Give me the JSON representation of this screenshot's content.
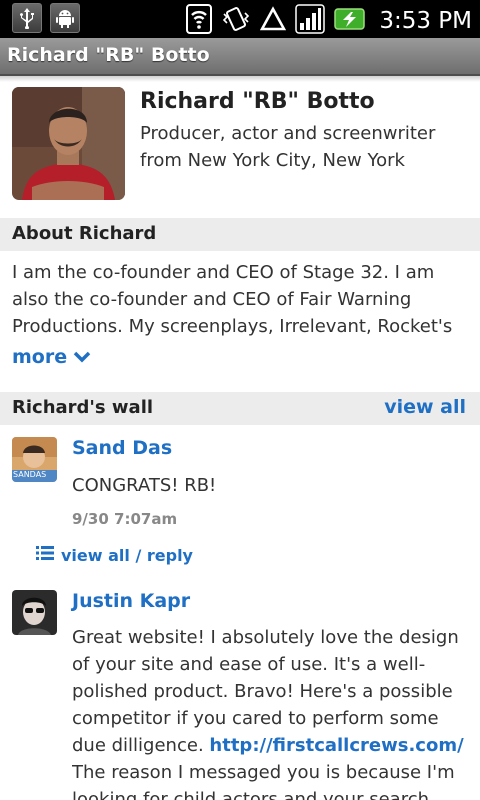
{
  "status_bar": {
    "time": "3:53 PM",
    "icons": [
      "usb-icon",
      "android-debug-icon",
      "wifi-icon",
      "vibrate-icon",
      "warning-icon",
      "signal-icon",
      "battery-charging-icon"
    ]
  },
  "title_bar": {
    "title": "Richard \"RB\" Botto"
  },
  "profile": {
    "name": "Richard \"RB\" Botto",
    "description": "Producer, actor and screenwriter from New York City, New York"
  },
  "about": {
    "header": "About Richard",
    "text": "I am the co-founder and CEO of Stage 32. I am also the co-founder and CEO of Fair Warning Productions. My screenplays, Irrelevant, Rocket's",
    "more_label": "more"
  },
  "wall": {
    "header": "Richard's wall",
    "view_all_label": "view all",
    "posts": [
      {
        "author": "Sand Das",
        "avatar_caption": "SANDAS",
        "text": "CONGRATS! RB!",
        "time": "9/30 7:07am",
        "reply_label": "view all / reply"
      },
      {
        "author": "Justin Kapr",
        "text_before_link": "Great website! I absolutely love the design of your site and ease of use. It's a well-polished product. Bravo! Here's a possible competitor if you cared to perform some due dilligence.",
        "link": "http://firstcallcrews.com/",
        "text_after_link": " The reason I messaged you is because I'm looking for child actors and your search engine omits"
      }
    ]
  },
  "colors": {
    "accent": "#1f6fc4",
    "section_bg": "#ececec",
    "titlebar": "#7e7e7e"
  }
}
